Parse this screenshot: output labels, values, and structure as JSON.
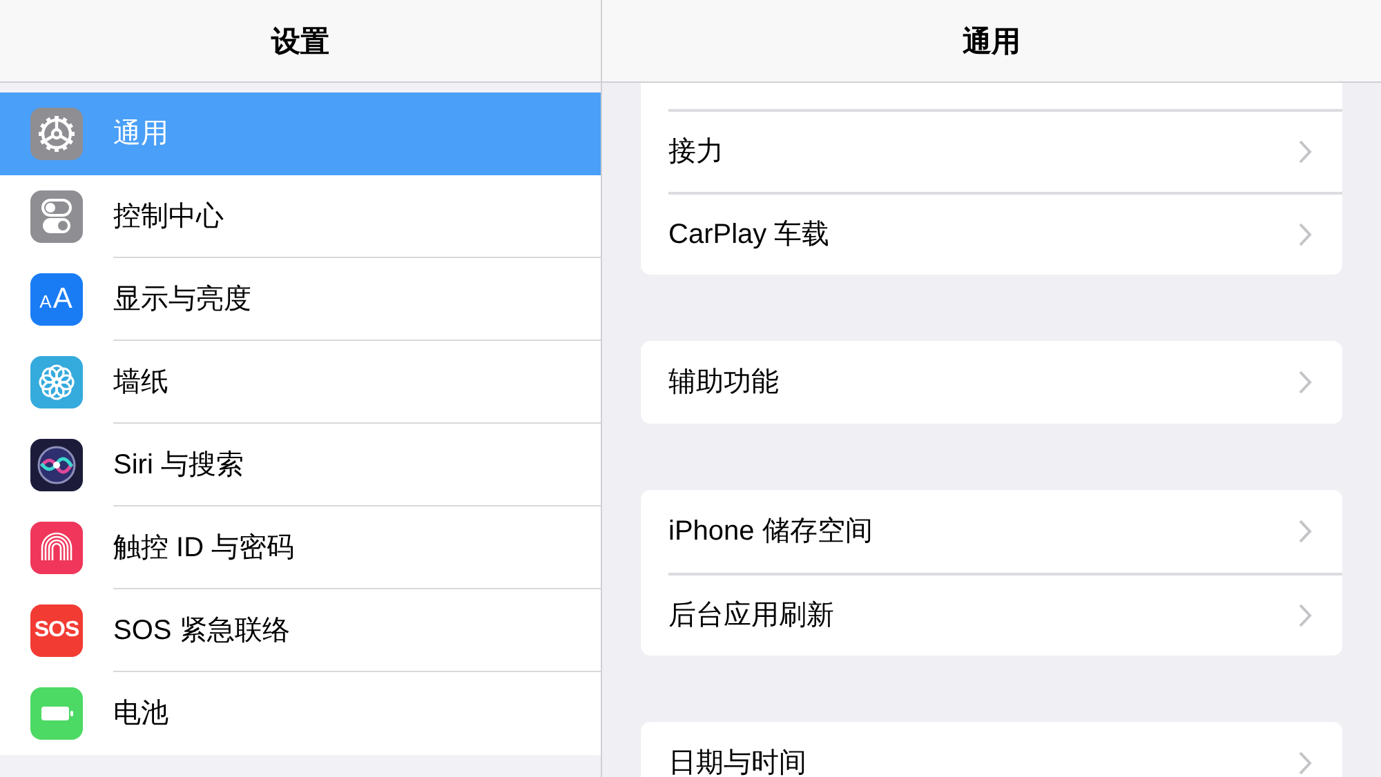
{
  "sidebar": {
    "title": "设置",
    "items": [
      {
        "label": "通用",
        "selected": true
      },
      {
        "label": "控制中心",
        "selected": false
      },
      {
        "label": "显示与亮度",
        "selected": false,
        "icon_text": "AA"
      },
      {
        "label": "墙纸",
        "selected": false
      },
      {
        "label": "Siri 与搜索",
        "selected": false
      },
      {
        "label": "触控 ID 与密码",
        "selected": false
      },
      {
        "label": "SOS 紧急联络",
        "selected": false,
        "icon_text": "SOS"
      },
      {
        "label": "电池",
        "selected": false
      }
    ]
  },
  "detail": {
    "title": "通用",
    "groups": [
      {
        "rows": [
          {
            "label": "接力"
          },
          {
            "label": "CarPlay 车载"
          }
        ]
      },
      {
        "rows": [
          {
            "label": "辅助功能"
          }
        ]
      },
      {
        "rows": [
          {
            "label": "iPhone 储存空间"
          },
          {
            "label": "后台应用刷新"
          }
        ]
      },
      {
        "rows": [
          {
            "label": "日期与时间"
          }
        ]
      }
    ]
  }
}
